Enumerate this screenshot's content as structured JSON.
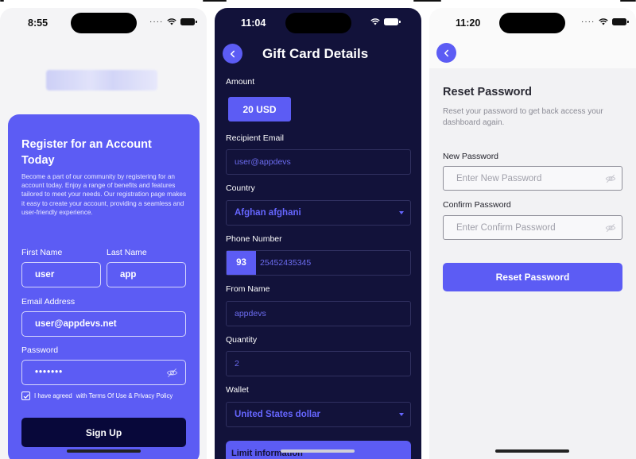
{
  "screen1": {
    "time": "8:55",
    "title": "Register for an Account Today",
    "description": "Become a part of our community by registering for an account today. Enjoy a range of benefits and features tailored to meet your needs. Our registration page makes it easy to create your account, providing a seamless and user-friendly experience.",
    "first_name_label": "First Name",
    "first_name_value": "user",
    "last_name_label": "Last Name",
    "last_name_value": "app",
    "email_label": "Email Address",
    "email_value": "user@appdevs.net",
    "password_label": "Password",
    "password_value": "•••••••",
    "agree_text": "I have agreed",
    "terms_text": "with Terms Of Use & Privacy Policy",
    "signup_label": "Sign Up"
  },
  "screen2": {
    "time": "11:04",
    "title": "Gift Card Details",
    "amount_label": "Amount",
    "amount_value": "20 USD",
    "recipient_label": "Recipient Email",
    "recipient_value": "user@appdevs",
    "country_label": "Country",
    "country_value": "Afghan afghani",
    "phone_label": "Phone Number",
    "phone_code": "93",
    "phone_value": "25452435345",
    "from_label": "From Name",
    "from_value": "appdevs",
    "quantity_label": "Quantity",
    "quantity_value": "2",
    "wallet_label": "Wallet",
    "wallet_value": "United States dollar",
    "limit_label": "Limit information"
  },
  "screen3": {
    "time": "11:20",
    "title": "Reset Password",
    "description": "Reset your password to get back access your dashboard again.",
    "new_password_label": "New Password",
    "new_password_placeholder": "Enter New Password",
    "confirm_password_label": "Confirm Password",
    "confirm_password_placeholder": "Enter Confirm Password",
    "reset_label": "Reset Password"
  },
  "colors": {
    "accent": "#5c5cf4",
    "dark_navy": "#12123a",
    "button_dark": "#08083a"
  },
  "icons": [
    "wifi-icon",
    "battery-icon",
    "eye-off-icon",
    "chevron-left-icon",
    "check-icon",
    "caret-down-icon"
  ]
}
